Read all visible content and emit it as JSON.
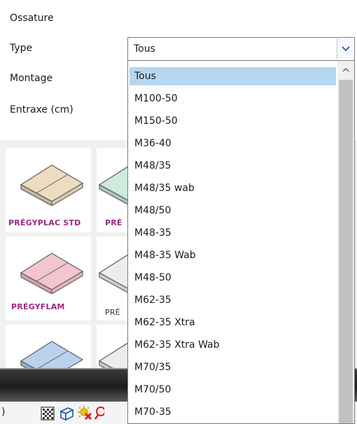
{
  "form": {
    "ossature_label": "Ossature",
    "type_label": "Type",
    "montage_label": "Montage",
    "entraxe_label": "Entraxe (cm)"
  },
  "type_select": {
    "value": "Tous",
    "options": [
      "Tous",
      "M100-50",
      "M150-50",
      "M36-40",
      "M48/35",
      "M48/35 wab",
      "M48/50",
      "M48-35",
      "M48-35 Wab",
      "M48-50",
      "M62-35",
      "M62-35 Xtra",
      "M62-35 Xtra Wab",
      "M70/35",
      "M70/50",
      "M70-35"
    ],
    "selected_index": 0
  },
  "products": [
    {
      "name": "PRÉGYPLAC STD",
      "color": "#ecdcc0",
      "name_color": "#9b2a7e"
    },
    {
      "name": "PRÉ",
      "color": "#cfe9dc",
      "name_color": "#9b2a7e"
    },
    {
      "name": "PRÉGYFLAM",
      "color": "#f2c6cf",
      "name_color": "#9b2a7e"
    },
    {
      "name": "PRÉ",
      "color": "#ededed",
      "name_color": "#333333"
    },
    {
      "name": "",
      "color": "#b9d2ee",
      "name_color": "#333333"
    },
    {
      "name": "",
      "color": "#ededed",
      "name_color": "#333333"
    }
  ],
  "status": {
    "left_fragment": ")",
    "icons": [
      "grid-icon",
      "cube-icon",
      "sun-delete-icon",
      "search-icon"
    ]
  },
  "colors": {
    "selection": "#b5d7f1",
    "scroll_thumb": "#c1c1c1",
    "chevron": "#1e5a9c"
  }
}
